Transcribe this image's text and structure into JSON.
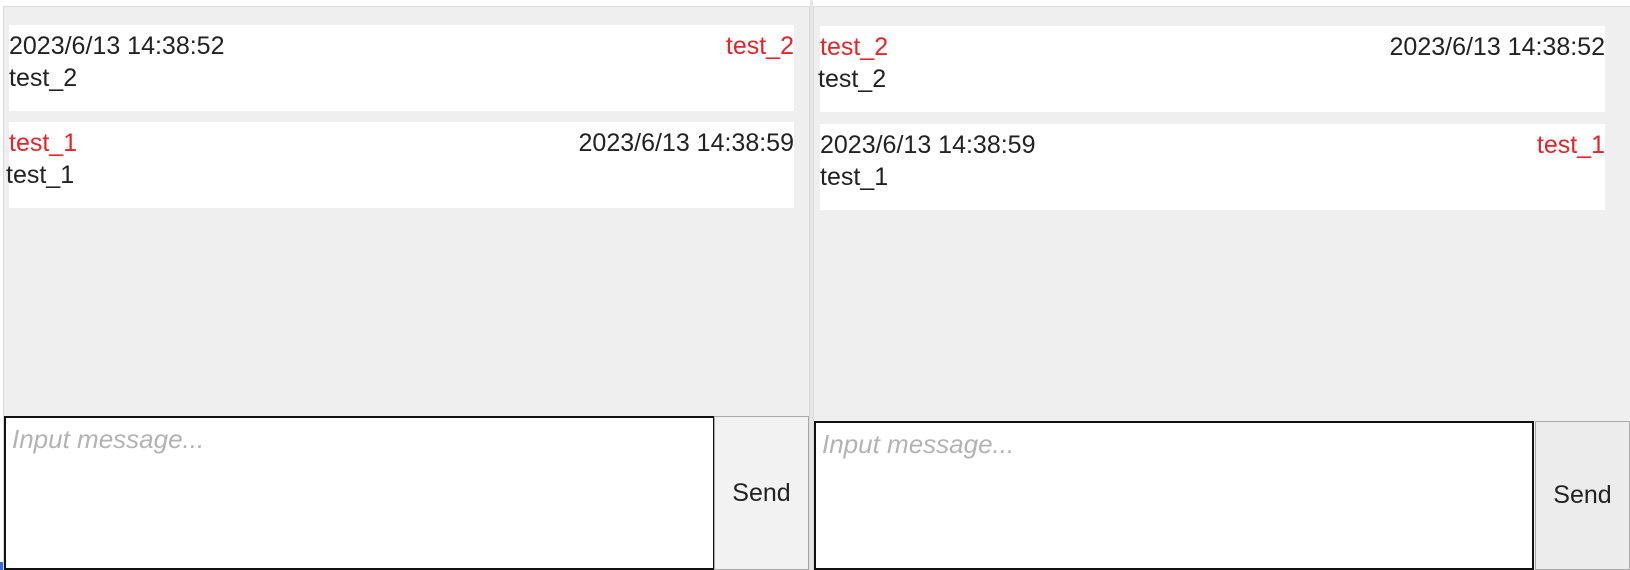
{
  "left_chat": {
    "messages": [
      {
        "sender": "test_2",
        "time": "2023/6/13 14:38:52",
        "text": "test_2"
      },
      {
        "sender": "test_1",
        "time": "2023/6/13 14:38:59",
        "text": "test_1"
      }
    ],
    "composer": {
      "placeholder": "Input message...",
      "send_label": "Send"
    }
  },
  "right_chat": {
    "messages": [
      {
        "sender": "test_2",
        "time": "2023/6/13 14:38:52",
        "text": "test_2"
      },
      {
        "sender": "test_1",
        "time": "2023/6/13 14:38:59",
        "text": "test_1"
      }
    ],
    "composer": {
      "placeholder": "Input message...",
      "send_label": "Send"
    }
  },
  "colors": {
    "sender": "#e8232a",
    "pane_background": "#efefef",
    "bubble_background": "#ffffff"
  }
}
